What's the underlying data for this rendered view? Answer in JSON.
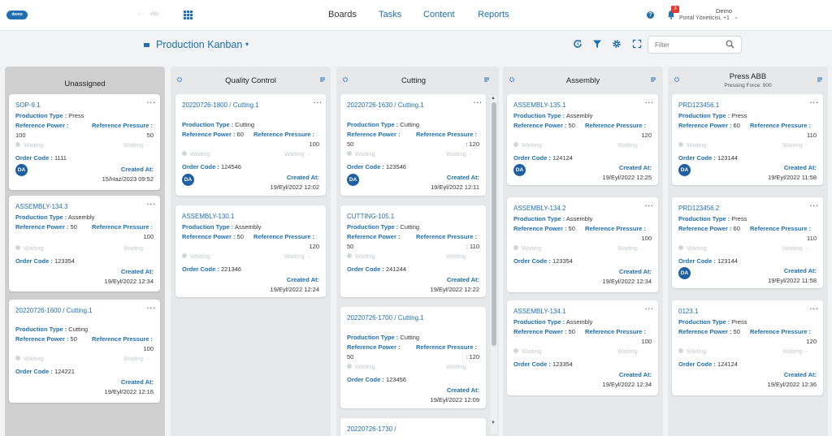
{
  "header": {
    "logo": "demo",
    "back_link": "‹ ··· ·ıılo",
    "nav": [
      "Boards",
      "Tasks",
      "Content",
      "Reports"
    ],
    "notifications": "3",
    "user_name": "Demo",
    "user_role": "Portal Yöneticisi, +1",
    "brand_color": "#1f6fb2"
  },
  "toolbar": {
    "board_title": "Production Kanban",
    "filter_placeholder": "Filter"
  },
  "labels": {
    "production_type": "Production Type :",
    "reference_power": "Reference Power :",
    "reference_pressure": "Reference Pressure :",
    "waiting": "Waiting",
    "order_code": "Order Code :",
    "created_at": "Created At:",
    "more": "···"
  },
  "columns": [
    {
      "title": "Unassigned",
      "subtitle": "",
      "cards": [
        {
          "title": "SOP-9.1",
          "type": "Press",
          "power": "100",
          "pressure": "50",
          "order": "1111",
          "avatar": "DA",
          "created": "15/Haz/2023 09:52"
        },
        {
          "title": "ASSEMBLY-134.3",
          "type": "Assembly",
          "power": "50",
          "pressure": "100",
          "order": "123354",
          "avatar": "",
          "created": "19/Eyl/2022 12:34"
        },
        {
          "title": "20220726-1600 / Cutting.1",
          "type": "Cutting",
          "power": "50",
          "pressure": "100",
          "order": "124221",
          "avatar": "",
          "created": "19/Eyl/2022 12:16"
        }
      ]
    },
    {
      "title": "Quality Control",
      "subtitle": "",
      "cards": [
        {
          "title": "20220726-1800 / Cutting.1",
          "type": "Cutting",
          "power": "60",
          "pressure": "100",
          "order": "124546",
          "avatar": "DA",
          "created": "19/Eyl/2022 12:02"
        },
        {
          "title": "ASSEMBLY-130.1",
          "type": "Assembly",
          "power": "50",
          "pressure": "120",
          "order": "221346",
          "avatar": "",
          "created": "19/Eyl/2022 12:24"
        }
      ]
    },
    {
      "title": "Cutting",
      "subtitle": "",
      "cards": [
        {
          "title": "20220726-1630 / Cutting.1",
          "type": "Cutting",
          "power": "50",
          "pressure": ": 120",
          "order": "123546",
          "avatar": "DA",
          "created": "19/Eyl/2022 12:11"
        },
        {
          "title": "CUTTING-105.1",
          "type": "Cutting",
          "power": "50",
          "pressure": ": 110",
          "order": "241244",
          "avatar": "",
          "created": "19/Eyl/2022 12:22"
        },
        {
          "title": "20220726-1700 / Cutting.1",
          "type": "Cutting",
          "power": "50",
          "pressure": ": 120",
          "order": "123456",
          "avatar": "",
          "created": "19/Eyl/2022 12:09"
        },
        {
          "title": "20220726-1730 /",
          "type": "",
          "power": "",
          "pressure": "",
          "order": "",
          "avatar": "",
          "created": ""
        }
      ]
    },
    {
      "title": "Assembly",
      "subtitle": "",
      "cards": [
        {
          "title": "ASSEMBLY-135.1",
          "type": "Assembly",
          "power": "50",
          "pressure": "120",
          "order": "124124",
          "avatar": "DA",
          "created": "19/Eyl/2022 12:25"
        },
        {
          "title": "ASSEMBLY-134.2",
          "type": "Assembly",
          "power": "50",
          "pressure": "100",
          "order": "123354",
          "avatar": "",
          "created": "19/Eyl/2022 12:34"
        },
        {
          "title": "ASSEMBLY-134.1",
          "type": "Assembly",
          "power": "50",
          "pressure": "100",
          "order": "123354",
          "avatar": "",
          "created": "19/Eyl/2022 12:34"
        }
      ]
    },
    {
      "title": "Press ABB",
      "subtitle": "Pressing Force: 900",
      "cards": [
        {
          "title": "PRD123456.1",
          "type": "Press",
          "power": "60",
          "pressure": "110",
          "order": "123144",
          "avatar": "DA",
          "created": "19/Eyl/2022 11:58"
        },
        {
          "title": "PRD123456.2",
          "type": "Press",
          "power": "60",
          "pressure": "110",
          "order": "123144",
          "avatar": "DA",
          "created": "19/Eyl/2022 11:58"
        },
        {
          "title": "0123.1",
          "type": "Press",
          "power": "50",
          "pressure": "120",
          "order": "124124",
          "avatar": "",
          "created": "19/Eyl/2022 12:36"
        }
      ]
    }
  ]
}
